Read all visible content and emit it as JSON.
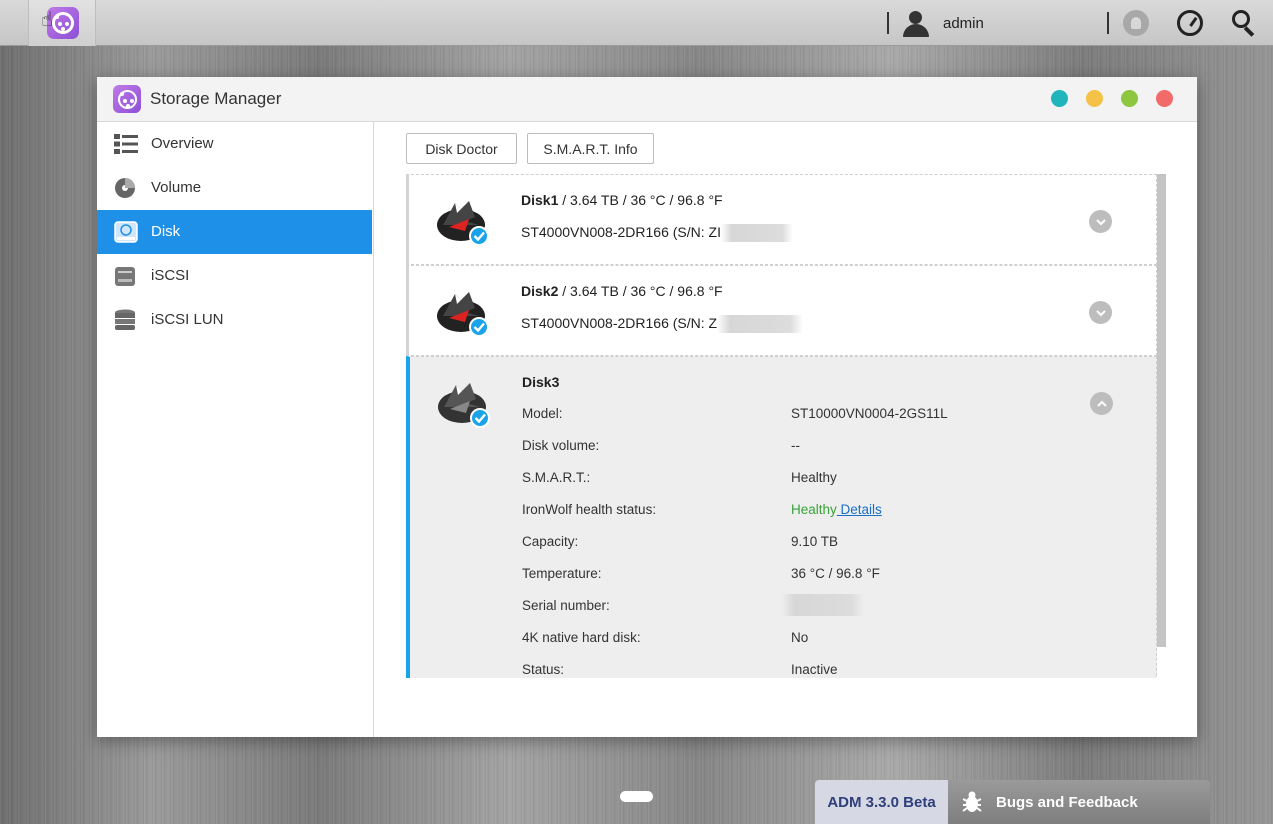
{
  "topbar": {
    "username": "admin"
  },
  "window": {
    "title": "Storage Manager",
    "controls": [
      {
        "name": "info",
        "color": "#1fb5bb"
      },
      {
        "name": "minimize",
        "color": "#f4c246"
      },
      {
        "name": "maximize",
        "color": "#8dc63f"
      },
      {
        "name": "close",
        "color": "#f26b6b"
      }
    ]
  },
  "sidebar": {
    "items": [
      {
        "label": "Overview",
        "icon": "list-icon"
      },
      {
        "label": "Volume",
        "icon": "volume-icon"
      },
      {
        "label": "Disk",
        "icon": "disk-icon",
        "active": true
      },
      {
        "label": "iSCSI",
        "icon": "iscsi-icon"
      },
      {
        "label": "iSCSI LUN",
        "icon": "database-icon"
      }
    ]
  },
  "toolbar": {
    "disk_doctor": "Disk Doctor",
    "smart_info": "S.M.A.R.T. Info"
  },
  "disks": [
    {
      "name": "Disk1",
      "summary": " / 3.64 TB / 36 °C / 96.8 °F",
      "model_line": "ST4000VN008-2DR166 (S/N: ZI"
    },
    {
      "name": "Disk2",
      "summary": " / 3.64 TB / 36 °C / 96.8 °F",
      "model_line": "ST4000VN008-2DR166 (S/N: Z"
    },
    {
      "name": "Disk3",
      "details": [
        {
          "label": "Model:",
          "value": "ST10000VN0004-2GS11L"
        },
        {
          "label": "Disk volume:",
          "value": "--"
        },
        {
          "label": "S.M.A.R.T.:",
          "value": "Healthy"
        },
        {
          "label": "IronWolf health status:",
          "value": "Healthy",
          "link": " Details"
        },
        {
          "label": "Capacity:",
          "value": "9.10 TB"
        },
        {
          "label": "Temperature:",
          "value": "36 °C / 96.8 °F"
        },
        {
          "label": "Serial number:",
          "value": ""
        },
        {
          "label": "4K native hard disk:",
          "value": "No"
        },
        {
          "label": "Status:",
          "value": "Inactive"
        }
      ]
    }
  ],
  "bottom": {
    "version": "ADM 3.3.0 Beta",
    "feedback": "Bugs and Feedback"
  }
}
